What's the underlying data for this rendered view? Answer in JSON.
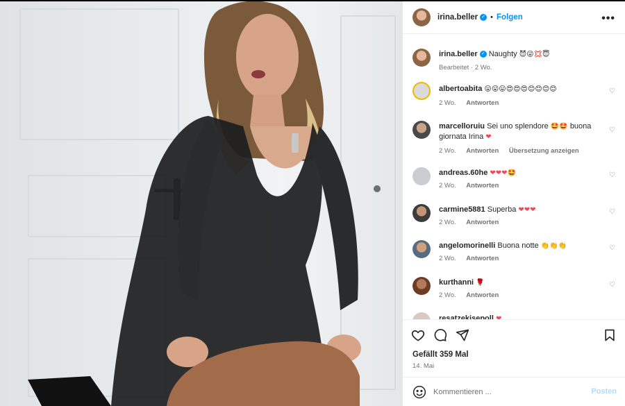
{
  "header": {
    "username": "irina.beller",
    "separator": "•",
    "follow_label": "Folgen",
    "more_label": "•••"
  },
  "caption": {
    "username": "irina.beller",
    "text": "Naughty",
    "emojis": "😈😜💢😇",
    "edited": "Bearbeitet",
    "time": "2 Wo."
  },
  "comments": [
    {
      "user": "albertoabita",
      "text": "",
      "emojis": "😛😛😛😍😍😍😊😊😊😊",
      "time": "2 Wo.",
      "reply": "Antworten",
      "translate": ""
    },
    {
      "user": "marcelloruiu",
      "text": "Sei uno splendore",
      "emojis": "🤩🤩",
      "text2": "buona giornata Irina",
      "emojis2": "❤",
      "time": "2 Wo.",
      "reply": "Antworten",
      "translate": "Übersetzung anzeigen"
    },
    {
      "user": "andreas.60he",
      "text": "",
      "emojis": "❤❤❤🤩",
      "time": "2 Wo.",
      "reply": "Antworten",
      "translate": ""
    },
    {
      "user": "carmine5881",
      "text": "Superba",
      "emojis": "❤❤❤",
      "time": "2 Wo.",
      "reply": "Antworten",
      "translate": ""
    },
    {
      "user": "angelomorinelli",
      "text": "Buona notte",
      "emojis": "👏👏👏",
      "time": "2 Wo.",
      "reply": "Antworten",
      "translate": ""
    },
    {
      "user": "kurthanni",
      "text": "",
      "emojis": "🌹",
      "time": "2 Wo.",
      "reply": "Antworten",
      "translate": ""
    },
    {
      "user": "resatzekisepoll",
      "text": "",
      "emojis": "❤",
      "time": "",
      "reply": "",
      "translate": ""
    }
  ],
  "post": {
    "likes": "Gefällt 359 Mal",
    "date": "14. Mai"
  },
  "composer": {
    "placeholder": "Kommentieren ...",
    "post_label": "Posten"
  },
  "icons": {
    "like": "heart-icon",
    "comment": "comment-icon",
    "share": "share-icon",
    "save": "bookmark-icon",
    "emoji": "emoji-icon",
    "verified": "verified-badge-icon",
    "comment_like": "heart-icon"
  },
  "colors": {
    "accent": "#0095f6",
    "muted": "#737373",
    "post_disabled": "#b3dbff",
    "heart": "#ed4956"
  }
}
